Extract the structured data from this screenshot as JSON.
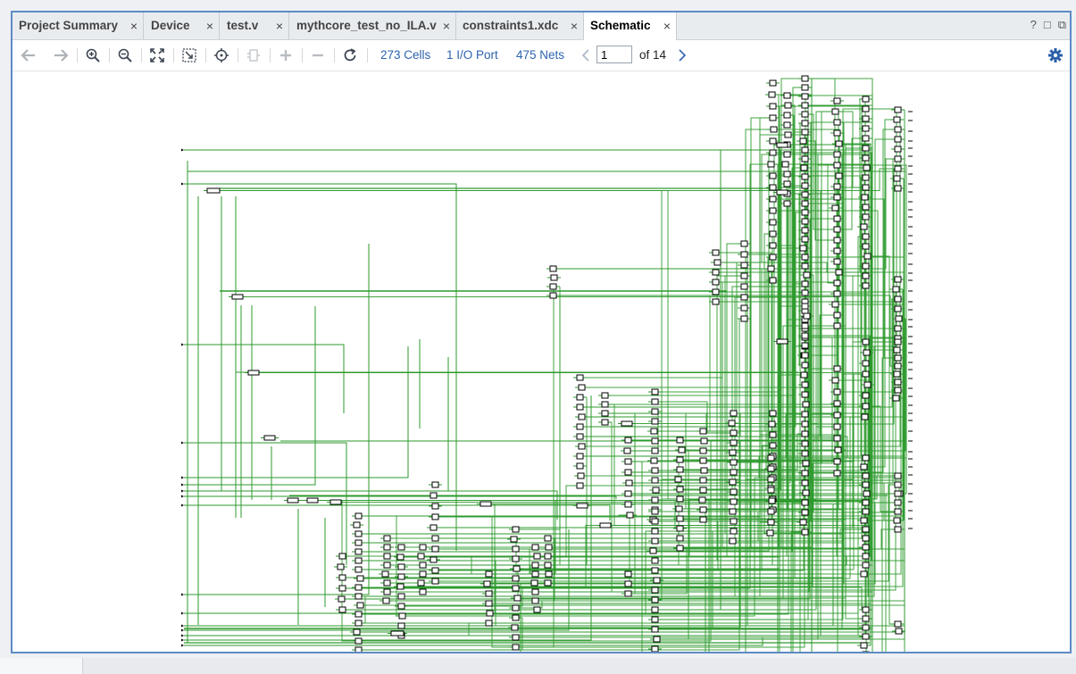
{
  "tabs": [
    {
      "label": "Project Summary",
      "active": false
    },
    {
      "label": "Device",
      "active": false
    },
    {
      "label": "test.v",
      "active": false
    },
    {
      "label": "mythcore_test_no_ILA.v",
      "active": false
    },
    {
      "label": "constraints1.xdc",
      "active": false
    },
    {
      "label": "Schematic",
      "active": true
    }
  ],
  "close_glyph": "×",
  "window_buttons": {
    "help": "?",
    "restore": "□",
    "float": "⧉"
  },
  "toolbar": {
    "icons": [
      "back-arrow-icon",
      "forward-arrow-icon",
      "zoom-in-icon",
      "zoom-out-icon",
      "zoom-fit-icon",
      "zoom-area-icon",
      "center-icon",
      "collapse-cell-icon",
      "expand-icon",
      "collapse-icon",
      "refresh-icon"
    ],
    "cells_link": "273 Cells",
    "ports_link": "1 I/O Port",
    "nets_link": "475 Nets",
    "page_value": "1",
    "of_pages": "of 14",
    "settings_icon": "gear-icon"
  },
  "colors": {
    "accent_border": "#5d8bc4",
    "link": "#2c63ae",
    "net_green": "#2e9a2e",
    "cell_outline": "#000000"
  }
}
